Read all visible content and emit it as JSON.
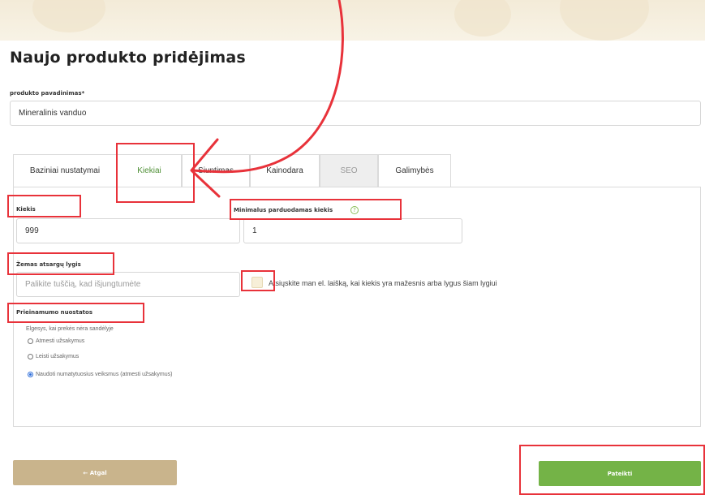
{
  "header": {
    "title": "Naujo produkto pridėjimas"
  },
  "product_name": {
    "label": "produkto pavadinimas*",
    "value": "Mineralinis vanduo"
  },
  "tabs": [
    {
      "label": "Baziniai nustatymai",
      "state": "normal"
    },
    {
      "label": "Kiekiai",
      "state": "active"
    },
    {
      "label": "Siuntimas",
      "state": "normal"
    },
    {
      "label": "Kainodara",
      "state": "normal"
    },
    {
      "label": "SEO",
      "state": "disabled"
    },
    {
      "label": "Galimybės",
      "state": "normal"
    }
  ],
  "quantities": {
    "quantity_label": "Kiekis",
    "quantity_value": "999",
    "min_qty_label": "Minimalus parduodamas kiekis",
    "min_qty_help_icon": "help-circle-icon",
    "min_qty_value": "1",
    "low_stock_label": "Žemas atsargų lygis",
    "low_stock_placeholder": "Palikite tuščią, kad išjungtumėte",
    "email_checkbox_label": "Atsiųskite man el. laišką, kai kiekis yra mažesnis arba lygus šiam lygiui",
    "email_checkbox_checked": false,
    "availability_label": "Prieinamumo nuostatos",
    "availability_hint": "Elgesys, kai prekės nėra sandėlyje",
    "availability_options": [
      {
        "label": "Atmesti užsakymus",
        "selected": false
      },
      {
        "label": "Leisti užsakymus",
        "selected": false
      },
      {
        "label": "Naudoti numatytuosius veiksmus (atmesti užsakymus)",
        "selected": true
      }
    ]
  },
  "footer": {
    "back_label": "← Atgal",
    "back_icon": "arrow-left-icon",
    "submit_label": "Pateikti"
  },
  "colors": {
    "accent_green": "#74b347",
    "active_tab_text": "#4e8f35",
    "back_button": "#c9b48c",
    "annotation_red": "#e8323a",
    "radio_selected": "#2b6cd9"
  }
}
